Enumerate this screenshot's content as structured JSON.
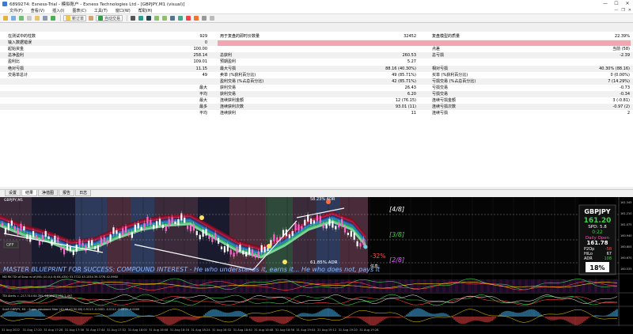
{
  "window": {
    "title": "6899274: Exness-Trial - 模拟账户 - Exness Technologies Ltd - [GBPJPY,M1 (visual)]"
  },
  "menu": [
    "文件(F)",
    "查看(V)",
    "插入(I)",
    "图表(C)",
    "工具(T)",
    "窗口(W)",
    "帮助(H)"
  ],
  "toolbar": {
    "new_order": "新订单",
    "auto_trading": "自动交易"
  },
  "report": {
    "rows": [
      {
        "c1": "在测试中的柱数",
        "c1v": "929",
        "c2": "用于复盘的即时价数量",
        "c2v": "32452",
        "c3": "复盘模型的质量",
        "c3v": "22.39%"
      },
      {
        "c1": "输入数据错误",
        "c1v": "0",
        "c2": "",
        "c2v": "",
        "c3": "",
        "c3v": ""
      },
      {
        "c1": "起始资金",
        "c1v": "100.00",
        "c2": "",
        "c2v": "",
        "c3": "点差",
        "c3v": "当前 (58)"
      },
      {
        "c1": "总净盈利",
        "c1v": "258.14",
        "c2": "总获利",
        "c2v": "260.53",
        "c3": "总亏损",
        "c3v": "-2.39"
      },
      {
        "c1": "盈利比",
        "c1v": "109.01",
        "c2": "预期盈利",
        "c2v": "5.27",
        "c3": "",
        "c3v": ""
      },
      {
        "c1": "绝对亏损",
        "c1v": "11.15",
        "c2": "最大亏损",
        "c2v": "88.16 (40.30%)",
        "c3": "相对亏损",
        "c3v": "40.30% (88.16)"
      },
      {
        "c1": "交易单总计",
        "c1v": "49",
        "c2": "卖单 (%获利百分比)",
        "c2v": "49 (85.71%)",
        "c3": "买单 (%获利百分比)",
        "c3v": "0 (0.00%)"
      },
      {
        "c1": "",
        "c1v": "",
        "c2": "盈利交易 (%占总百分比)",
        "c2v": "42 (85.71%)",
        "c3": "亏损交易 (%占总百分比)",
        "c3v": "7 (14.29%)"
      },
      {
        "c1": "",
        "c1v": "最大",
        "c2": "获利交易",
        "c2v": "26.43",
        "c3": "亏损交易",
        "c3v": "-0.73"
      },
      {
        "c1": "",
        "c1v": "平均",
        "c2": "获利交易",
        "c2v": "6.20",
        "c3": "亏损交易",
        "c3v": "-0.34"
      },
      {
        "c1": "",
        "c1v": "最大",
        "c2": "连续获利金额",
        "c2v": "12 (76.15)",
        "c3": "连续亏损金额",
        "c3v": "3 (-0.81)"
      },
      {
        "c1": "",
        "c1v": "最多",
        "c2": "连续获利次数",
        "c2v": "93.01 (11)",
        "c3": "连续亏损次数",
        "c3v": "-0.97 (2)"
      },
      {
        "c1": "",
        "c1v": "平均",
        "c2": "连续获利",
        "c2v": "11",
        "c3": "连续亏损",
        "c3v": "2"
      }
    ]
  },
  "tabs": [
    "设置",
    "结果",
    "净值图",
    "报告",
    "日志"
  ],
  "chart": {
    "header": "GBPJPY,M1",
    "overlay_labels": [
      "[4/8]",
      "[3/8]",
      "[2/8]"
    ],
    "drawdown_label": "-32%",
    "adr_label": "61.85% ADR",
    "adr_top_label": "58.23% ADR",
    "banner": "MASTER BLUEPRINT FOR SUCCESS: COMPOUND INTEREST - He who understands it, earns it... He who does not, pays it",
    "off_label": "OFF",
    "info_label": "信息:",
    "info_panel": {
      "symbol": "GBPJPY",
      "price": "161.20",
      "spd": "SPD: 5.8",
      "time": "0:22",
      "daily_open_label": "Daily Open",
      "daily_open": "161.78",
      "p2op_label": "P2Op",
      "p2op": "-58",
      "hilo_label": "HiLo",
      "hilo": "67",
      "adr_label": "ADR",
      "adr": "108",
      "pct": "18%"
    },
    "price_scale": [
      "161.345",
      "161.210",
      "161.075",
      "160.940",
      "160.805",
      "160.670",
      "160.535"
    ],
    "sub1_label": "MD RK TDI of Slow rsi of JMA (10,0,0.6) 64.4350 53.7722 43.1054 39.3778 42.5960",
    "sub2_label": "TDI Alerts = -217.314 64.395 -18.223 0.000 2.497",
    "sub3_label": "Sub5 GBPJPY, M1 : Super passband filter (40,08,40,50,60) 0.9113 -0.0001 -0.0112 -0.0019 -0.0009",
    "time_labels": [
      "31 Aug 2022",
      "31 Aug 17:20",
      "31 Aug 17:28",
      "31 Aug 17:36",
      "31 Aug 17:44",
      "31 Aug 17:52",
      "31 Aug 18:00",
      "31 Aug 18:08",
      "31 Aug 18:16",
      "31 Aug 18:24",
      "31 Aug 18:32",
      "31 Aug 18:40",
      "31 Aug 18:48",
      "31 Aug 18:56",
      "31 Aug 19:04",
      "31 Aug 19:12",
      "31 Aug 19:20",
      "31 Aug 19:28"
    ]
  }
}
